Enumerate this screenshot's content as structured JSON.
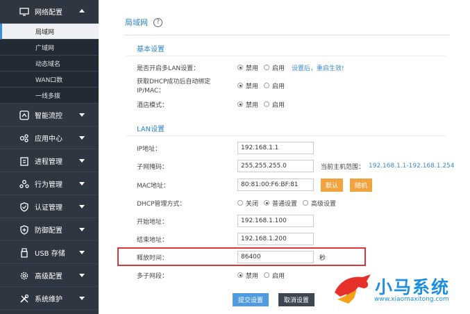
{
  "sidebar": {
    "network": "网络配置",
    "sub": [
      "局域网",
      "广域网",
      "动态域名",
      "WAN口数",
      "一线多拨"
    ],
    "items": [
      "智能流控",
      "应用中心",
      "进程管理",
      "行为管理",
      "认证管理",
      "防御配置",
      "USB 存储",
      "高级配置",
      "系统维护"
    ]
  },
  "title": "局域网",
  "help": "?",
  "basic": {
    "heading": "基本设置",
    "rows": [
      {
        "label": "是否开启多LAN设置：",
        "opt1": "禁用",
        "opt2": "启用",
        "hint": "设置后，重启生效!"
      },
      {
        "label": "获取DHCP成功后自动绑定IP/MAC：",
        "opt1": "禁用",
        "opt2": "启用"
      },
      {
        "label": "酒店模式：",
        "opt1": "禁用",
        "opt2": "启用"
      }
    ]
  },
  "lan": {
    "heading": "LAN设置",
    "ip_label": "IP地址：",
    "ip": "192.168.1.1",
    "mask_label": "子网掩码：",
    "mask": "255.255.255.0",
    "range_label": "当前主机范围：",
    "range": "192.168.1.1-192.168.1.254",
    "mac_label": "MAC地址：",
    "mac": "80:81:00:F6:BF:81",
    "default_btn": "默认",
    "random_btn": "随机",
    "dhcp_label": "DHCP管理方式：",
    "dhcp_off": "关闭",
    "dhcp_normal": "普通设置",
    "dhcp_adv": "高级设置",
    "start_label": "开始地址：",
    "start": "192.168.1.100",
    "end_label": "结束地址：",
    "end": "192.168.1.200",
    "lease_label": "释放时间：",
    "lease": "86400",
    "lease_unit": "秒",
    "multi_label": "多子网段：",
    "multi_off": "禁用",
    "multi_on": "启用"
  },
  "submit": "提交设置",
  "cancel": "取消设置",
  "watermark": {
    "name": "小马系统",
    "url": "www.xiaomaxitong.com"
  }
}
